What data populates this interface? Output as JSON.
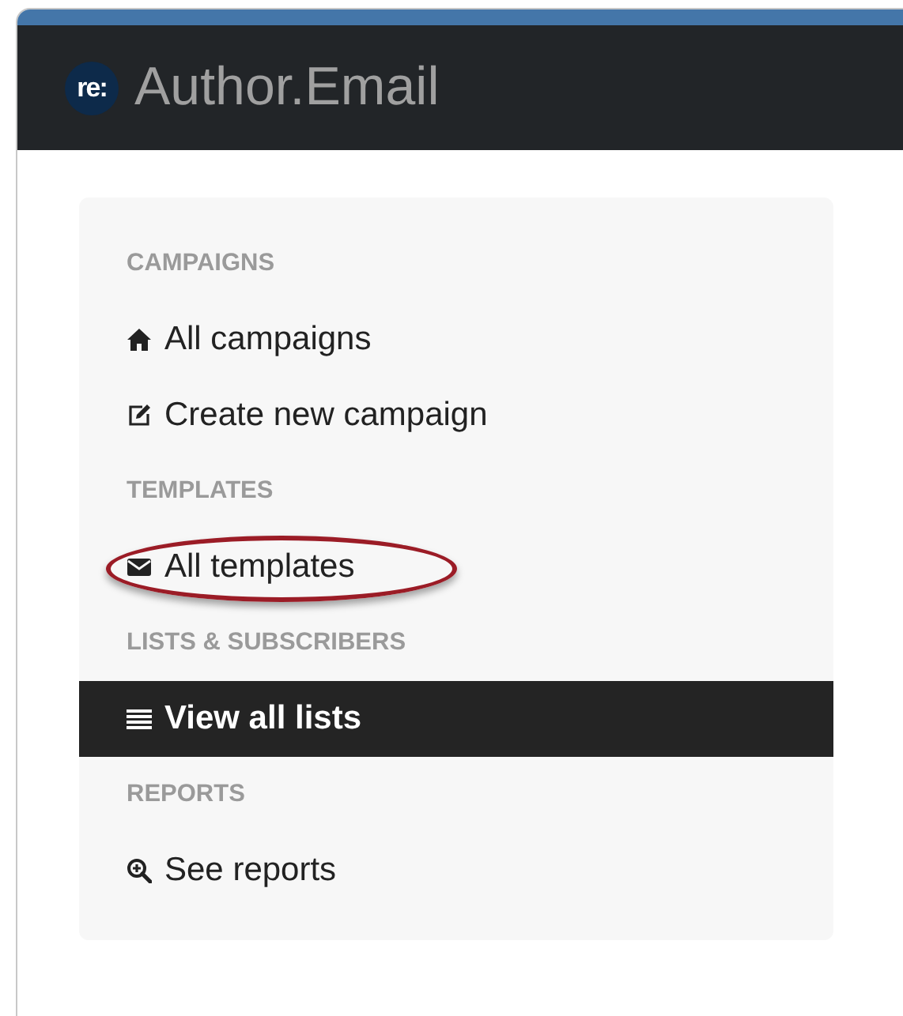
{
  "header": {
    "logo": "re:",
    "title": "Author.Email"
  },
  "sidebar": {
    "sections": [
      {
        "title": "CAMPAIGNS",
        "items": [
          {
            "label": "All campaigns",
            "kind": "home",
            "selected": false,
            "circled": false
          },
          {
            "label": "Create new campaign",
            "kind": "edit",
            "selected": false,
            "circled": false
          }
        ]
      },
      {
        "title": "TEMPLATES",
        "items": [
          {
            "label": "All templates",
            "kind": "envelope",
            "selected": false,
            "circled": true
          }
        ]
      },
      {
        "title": "LISTS & SUBSCRIBERS",
        "items": [
          {
            "label": "View all lists",
            "kind": "list",
            "selected": true,
            "circled": false
          }
        ]
      },
      {
        "title": "REPORTS",
        "items": [
          {
            "label": "See reports",
            "kind": "zoom",
            "selected": false,
            "circled": false
          }
        ]
      }
    ]
  }
}
